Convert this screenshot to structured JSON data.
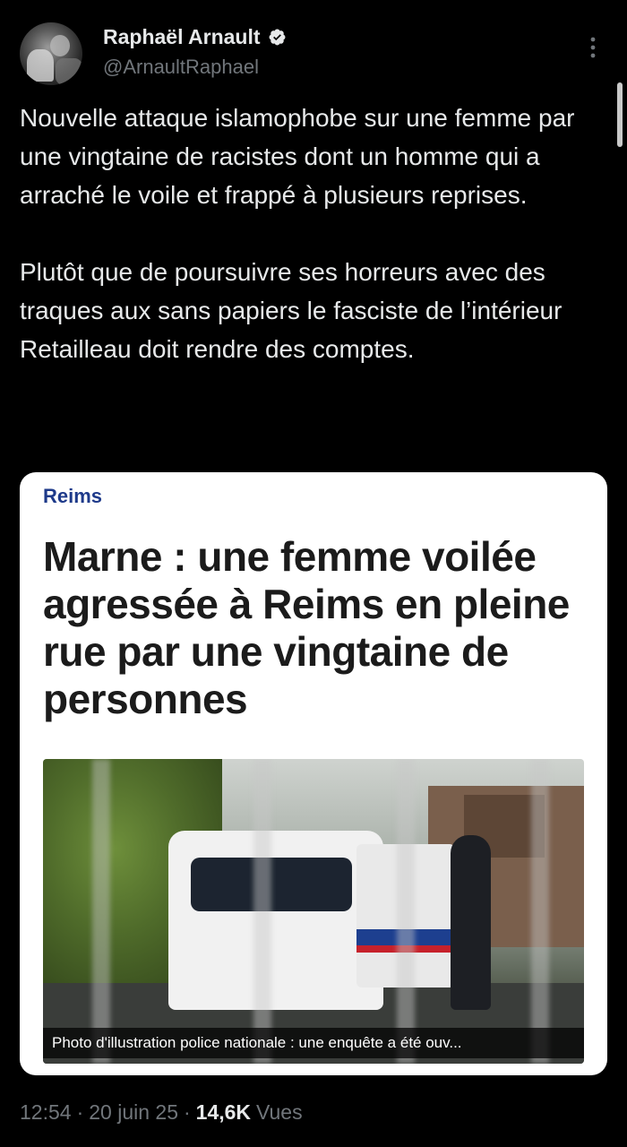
{
  "author": {
    "display_name": "Raphaël Arnault",
    "handle": "@ArnaultRaphael",
    "verified": true,
    "verified_color": "#e7e9ea"
  },
  "tweet": {
    "text": "Nouvelle attaque islamophobe sur une femme par une vingtaine de racistes dont un homme qui a arraché le voile et frappé à plusieurs reprises.\n\nPlutôt que de poursuivre ses horreurs avec des traques aux sans papiers le fasciste de l’intérieur Retailleau doit rendre des comptes."
  },
  "card": {
    "section": "Reims",
    "title": "Marne : une femme voilée agressée à Reims en pleine rue par une vingtaine de personnes",
    "photo_caption": "Photo d'illustration police nationale : une enquête a été ouv..."
  },
  "meta": {
    "time": "12:54",
    "separator": "·",
    "date": "20 juin 25",
    "views_count": "14,6K",
    "views_label": "Vues"
  },
  "icons": {
    "more": "more-vertical-icon",
    "verified": "verified-badge-icon"
  }
}
